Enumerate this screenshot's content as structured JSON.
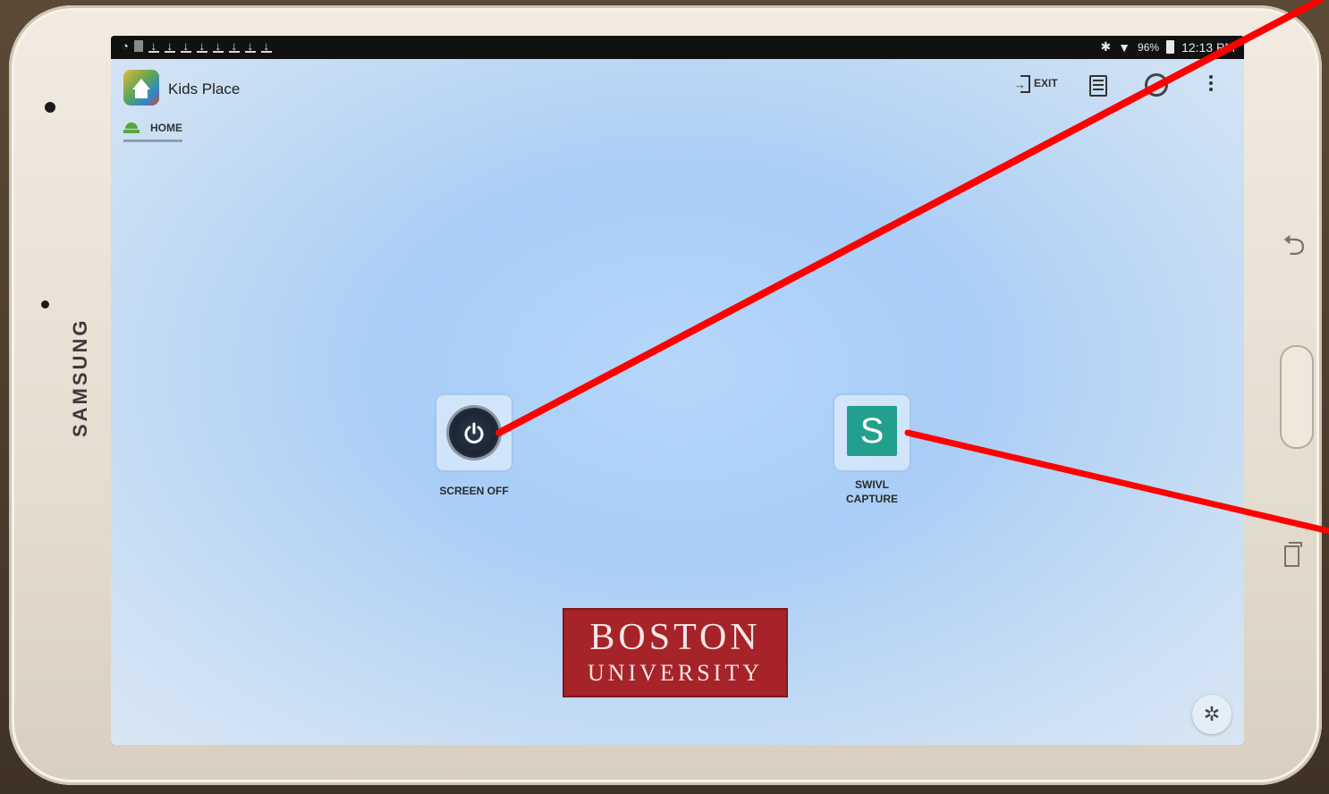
{
  "device": {
    "brand": "SAMSUNG"
  },
  "statusbar": {
    "download_icons": 8,
    "battery": "96%",
    "time": "12:13 PM"
  },
  "app": {
    "title": "Kids Place",
    "actions": {
      "exit_label": "EXIT"
    }
  },
  "tabs": [
    {
      "label": "HOME"
    }
  ],
  "tiles": [
    {
      "label": "SCREEN OFF",
      "icon": "power-icon"
    },
    {
      "label_line1": "SWIVL",
      "label_line2": "CAPTURE",
      "glyph": "S",
      "color": "#23a08d"
    }
  ],
  "logo": {
    "line1": "BOSTON",
    "line2": "UNIVERSITY",
    "color": "#a6232a"
  },
  "annotation": {
    "arrow_color": "#ff0000"
  }
}
